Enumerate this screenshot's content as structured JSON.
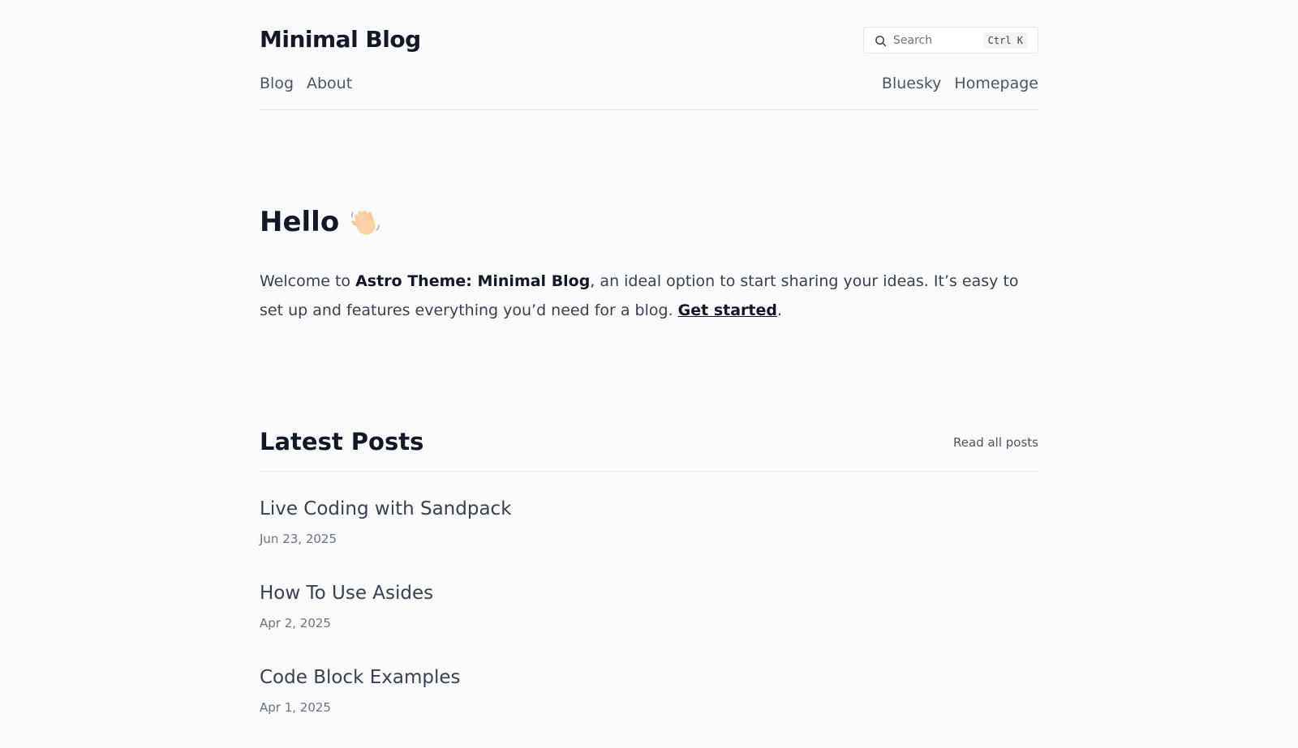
{
  "header": {
    "brand": "Minimal Blog",
    "search": {
      "placeholder": "Search",
      "shortcut": "Ctrl K"
    },
    "nav_left": [
      {
        "label": "Blog"
      },
      {
        "label": "About"
      }
    ],
    "nav_right": [
      {
        "label": "Bluesky"
      },
      {
        "label": "Homepage"
      }
    ]
  },
  "hero": {
    "title": "Hello",
    "icon": "waving-hand-icon",
    "text_before": "Welcome to ",
    "text_strong": "Astro Theme: Minimal Blog",
    "text_middle": ", an ideal option to start sharing your ideas. It’s easy to set up and features everything you’d need for a blog. ",
    "link_label": "Get started",
    "text_after": "."
  },
  "latest": {
    "title": "Latest Posts",
    "read_all_label": "Read all posts",
    "posts": [
      {
        "title": "Live Coding with Sandpack",
        "date": "Jun 23, 2025"
      },
      {
        "title": "How To Use Asides",
        "date": "Apr 2, 2025"
      },
      {
        "title": "Code Block Examples",
        "date": "Apr 1, 2025"
      }
    ]
  },
  "colors": {
    "background": "#f9fafb",
    "heading": "#111827",
    "body_text": "#374151",
    "muted": "#6b7280",
    "divider": "#e5e7eb"
  }
}
